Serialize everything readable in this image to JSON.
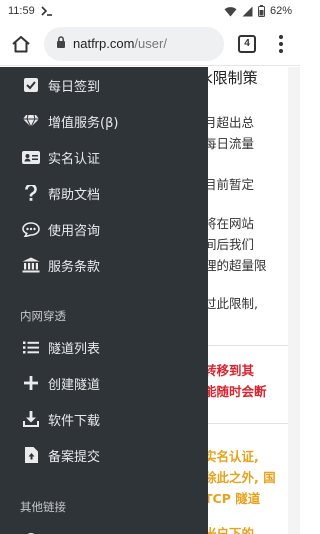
{
  "status_bar": {
    "time": "11:59",
    "battery": "62%"
  },
  "browser": {
    "url_host": "natfrp.com",
    "url_path": "/user/",
    "tab_count": "4"
  },
  "drawer": {
    "items_top": [
      {
        "label": "每日签到",
        "icon": "check-square-icon"
      },
      {
        "label": "增值服务(β)",
        "icon": "diamond-icon"
      },
      {
        "label": "实名认证",
        "icon": "id-card-icon"
      },
      {
        "label": "帮助文档",
        "icon": "question-icon"
      },
      {
        "label": "使用咨询",
        "icon": "chat-icon"
      },
      {
        "label": "服务条款",
        "icon": "bank-icon"
      }
    ],
    "section_tunnel": "内网穿透",
    "items_tunnel": [
      {
        "label": "隧道列表",
        "icon": "list-icon"
      },
      {
        "label": "创建隧道",
        "icon": "plus-icon"
      },
      {
        "label": "软件下载",
        "icon": "download-icon"
      },
      {
        "label": "备案提交",
        "icon": "file-upload-icon"
      }
    ],
    "section_other": "其他链接"
  },
  "page": {
    "lines": [
      {
        "text": "k限制策",
        "style": "heading"
      },
      {
        "text": "月超出总",
        "style": "normal"
      },
      {
        "text": "每日流量",
        "style": "normal"
      },
      {
        "text": "目前暂定",
        "style": "normal"
      },
      {
        "text": "将在网站",
        "style": "normal"
      },
      {
        "text": "间后我们",
        "style": "normal"
      },
      {
        "text": "理的超量限",
        "style": "normal"
      },
      {
        "text": "过此限制,",
        "style": "normal"
      },
      {
        "text": "转移到其",
        "style": "red"
      },
      {
        "text": "能随时会断",
        "style": "red"
      },
      {
        "text": "实名认证,",
        "style": "orange"
      },
      {
        "text": "除此之外, 国",
        "style": "orange"
      },
      {
        "text": "TCP 隧道",
        "style": "orange"
      },
      {
        "text": "米户下的",
        "style": "orange"
      }
    ]
  }
}
